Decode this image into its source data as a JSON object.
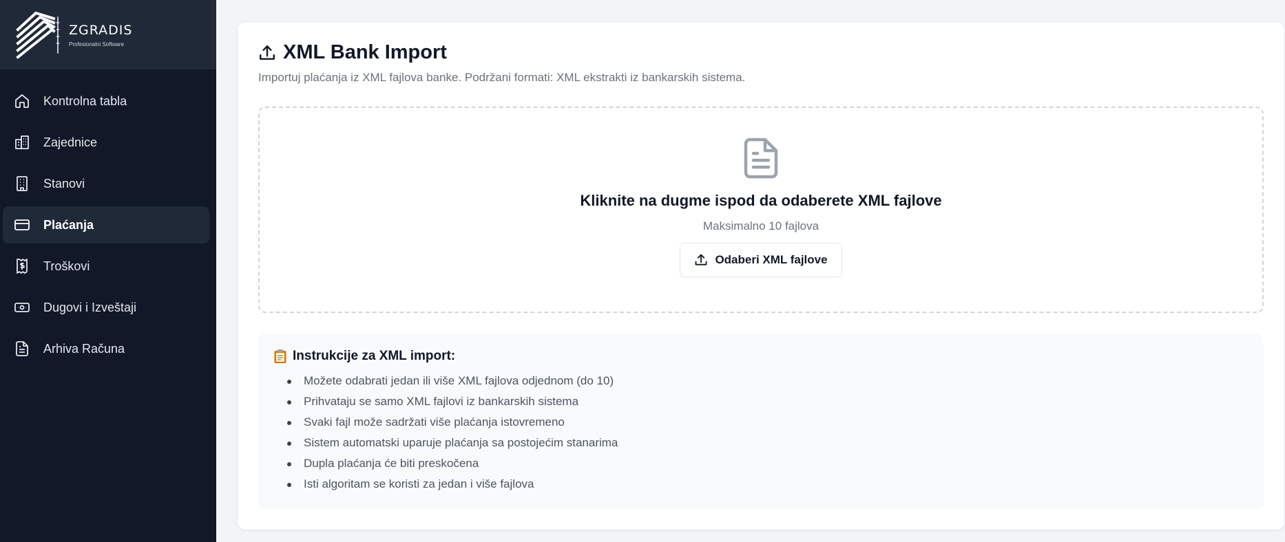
{
  "brand": {
    "name": "ZGRADIS",
    "tagline": "Profesionalni Software"
  },
  "sidebar": {
    "items": [
      {
        "label": "Kontrolna tabla",
        "icon": "home-icon",
        "active": false
      },
      {
        "label": "Zajednice",
        "icon": "building-icon",
        "active": false
      },
      {
        "label": "Stanovi",
        "icon": "apartment-icon",
        "active": false
      },
      {
        "label": "Plaćanja",
        "icon": "credit-card-icon",
        "active": true
      },
      {
        "label": "Troškovi",
        "icon": "receipt-icon",
        "active": false
      },
      {
        "label": "Dugovi i Izveštaji",
        "icon": "banknote-icon",
        "active": false
      },
      {
        "label": "Arhiva Računa",
        "icon": "document-icon",
        "active": false
      }
    ]
  },
  "page": {
    "title": "XML Bank Import",
    "subtitle": "Importuj plaćanja iz XML fajlova banke. Podržani formati: XML ekstrakti iz bankarskih sistema."
  },
  "dropzone": {
    "title": "Kliknite na dugme ispod da odaberete XML fajlove",
    "subtitle": "Maksimalno 10 fajlova",
    "button_label": "Odaberi XML fajlove"
  },
  "instructions": {
    "title": "Instrukcije za XML import:",
    "items": [
      "Možete odabrati jedan ili više XML fajlova odjednom (do 10)",
      "Prihvataju se samo XML fajlovi iz bankarskih sistema",
      "Svaki fajl može sadržati više plaćanja istovremeno",
      "Sistem automatski uparuje plaćanja sa postojećim stanarima",
      "Dupla plaćanja će biti preskočena",
      "Isti algoritam se koristi za jedan i više fajlova"
    ]
  },
  "colors": {
    "sidebar_bg": "#111827",
    "sidebar_active": "#1f2937",
    "accent_text": "#111827",
    "muted_text": "#6b7280"
  }
}
